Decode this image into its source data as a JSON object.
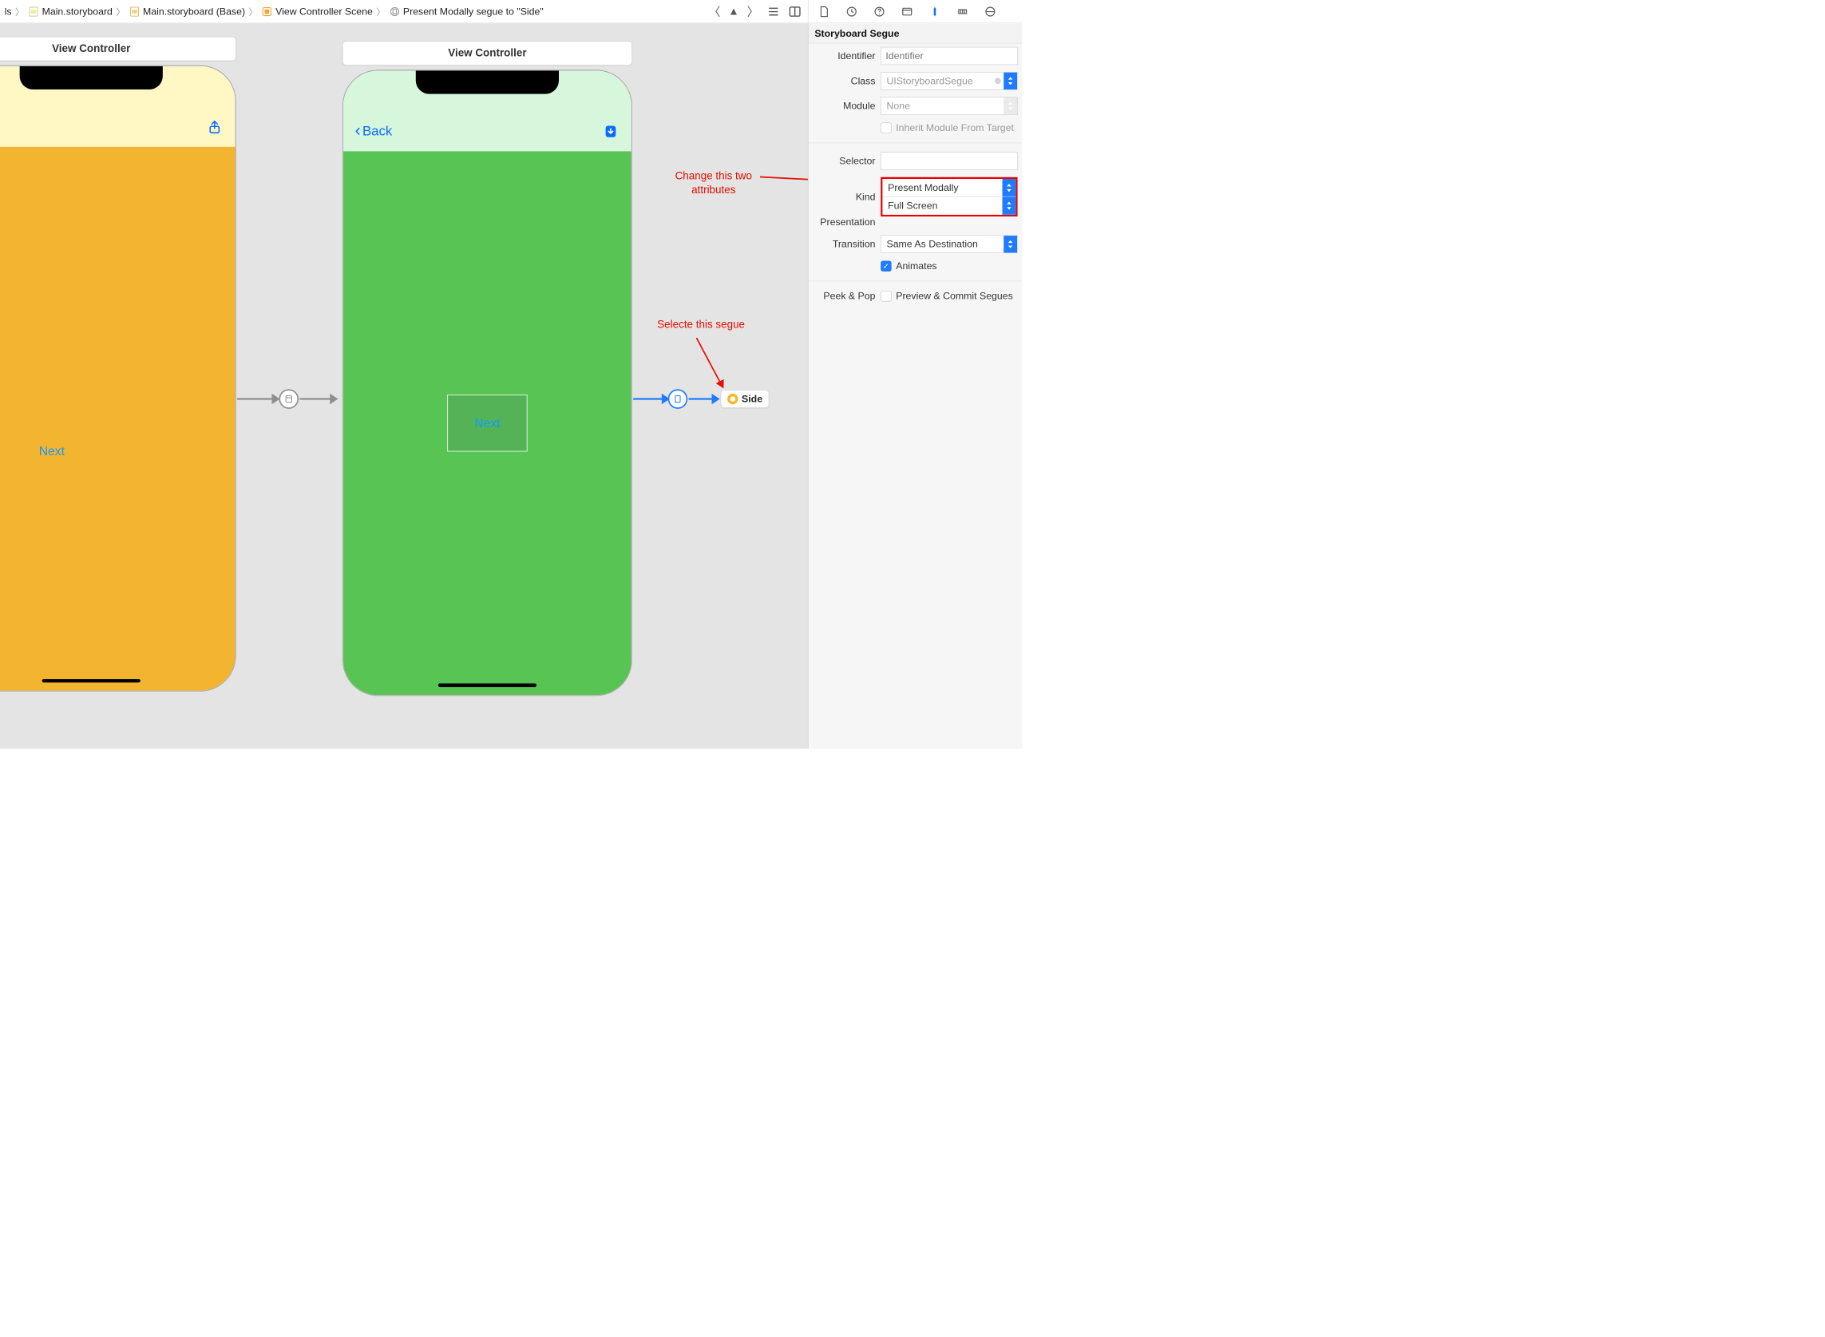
{
  "breadcrumb": {
    "item0": "ls",
    "item1": "Main.storyboard",
    "item2": "Main.storyboard (Base)",
    "item3": "View Controller Scene",
    "item4": "Present Modally segue to \"Side\""
  },
  "canvas": {
    "vc1_title": "View Controller",
    "vc2_title": "View Controller",
    "vc1_button": "Next",
    "vc2_back": "Back",
    "vc2_button": "Next",
    "side_chip": "Side"
  },
  "annotations": {
    "segue": "Selecte this segue",
    "attrs_l1": "Change this two",
    "attrs_l2": "attributes"
  },
  "inspector": {
    "header": "Storyboard Segue",
    "identifier_label": "Identifier",
    "identifier_placeholder": "Identifier",
    "class_label": "Class",
    "class_value": "UIStoryboardSegue",
    "module_label": "Module",
    "module_value": "None",
    "inherit_label": "Inherit Module From Target",
    "selector_label": "Selector",
    "selector_value": "",
    "kind_label": "Kind",
    "kind_value": "Present Modally",
    "presentation_label": "Presentation",
    "presentation_value": "Full Screen",
    "transition_label": "Transition",
    "transition_value": "Same As Destination",
    "animates_label": "Animates",
    "peekpop_label": "Peek & Pop",
    "peekpop_option": "Preview & Commit Segues"
  }
}
